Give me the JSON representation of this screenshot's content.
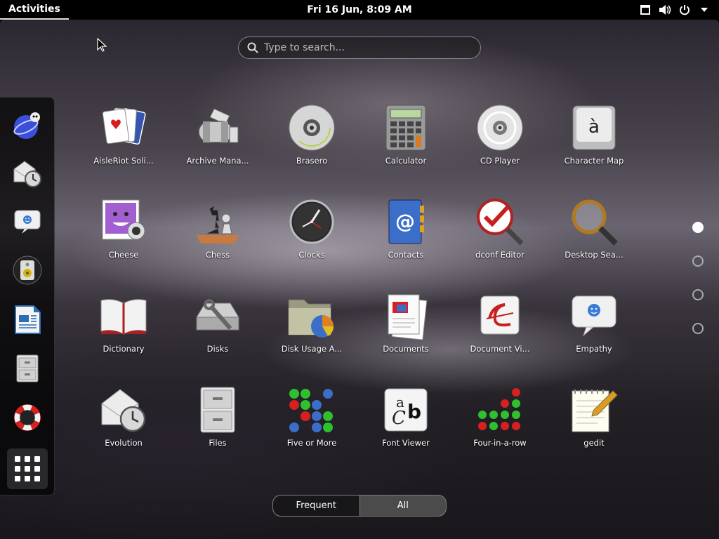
{
  "topbar": {
    "activities": "Activities",
    "clock": "Fri 16 Jun,  8:09 AM",
    "tray_icons": [
      "window-icon",
      "volume-icon",
      "power-icon",
      "dropdown-arrow-icon"
    ]
  },
  "search": {
    "placeholder": "Type to search..."
  },
  "dash": {
    "items": [
      "pidgin-icon",
      "evolution-icon",
      "empathy-icon",
      "rhythmbox-icon",
      "writer-icon",
      "files-icon",
      "help-icon"
    ],
    "show_apps": "show-applications-icon"
  },
  "apps": [
    {
      "label": "AisleRiot Soli...",
      "icon": "cards-icon"
    },
    {
      "label": "Archive Mana...",
      "icon": "archive-icon"
    },
    {
      "label": "Brasero",
      "icon": "disc-burner-icon"
    },
    {
      "label": "Calculator",
      "icon": "calculator-icon"
    },
    {
      "label": "CD Player",
      "icon": "cd-icon"
    },
    {
      "label": "Character Map",
      "icon": "keyboard-key-icon"
    },
    {
      "label": "Cheese",
      "icon": "webcam-icon"
    },
    {
      "label": "Chess",
      "icon": "chess-icon"
    },
    {
      "label": "Clocks",
      "icon": "clock-icon"
    },
    {
      "label": "Contacts",
      "icon": "address-book-icon"
    },
    {
      "label": "dconf Editor",
      "icon": "checkmark-magnifier-icon"
    },
    {
      "label": "Desktop Sea...",
      "icon": "magnifier-icon"
    },
    {
      "label": "Dictionary",
      "icon": "book-icon"
    },
    {
      "label": "Disks",
      "icon": "disk-utility-icon"
    },
    {
      "label": "Disk Usage A...",
      "icon": "disk-usage-icon"
    },
    {
      "label": "Documents",
      "icon": "documents-icon"
    },
    {
      "label": "Document Vi...",
      "icon": "document-viewer-icon"
    },
    {
      "label": "Empathy",
      "icon": "chat-bubble-icon"
    },
    {
      "label": "Evolution",
      "icon": "mail-clock-icon"
    },
    {
      "label": "Files",
      "icon": "file-cabinet-icon"
    },
    {
      "label": "Five or More",
      "icon": "colored-balls-icon"
    },
    {
      "label": "Font Viewer",
      "icon": "font-icon"
    },
    {
      "label": "Four-in-a-row",
      "icon": "four-in-row-icon"
    },
    {
      "label": "gedit",
      "icon": "text-editor-icon"
    }
  ],
  "pages": {
    "count": 4,
    "current": 1
  },
  "view_switch": {
    "frequent": "Frequent",
    "all": "All",
    "selected": "All"
  }
}
